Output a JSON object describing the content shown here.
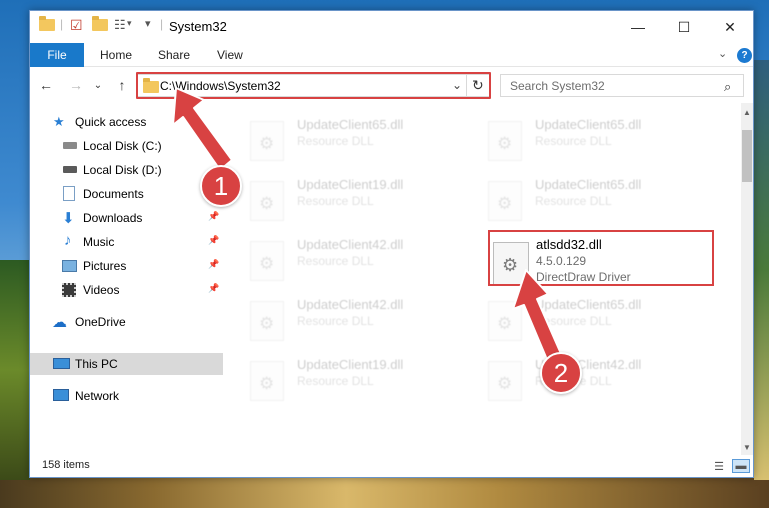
{
  "window": {
    "title": "System32"
  },
  "window_controls": {
    "minimize": "—",
    "maximize": "☐",
    "close": "✕"
  },
  "ribbon": {
    "file": "File",
    "tabs": [
      "Home",
      "Share",
      "View"
    ],
    "expand": "⌄",
    "help": "?"
  },
  "address": {
    "path": "C:\\Windows\\System32",
    "dropdown": "⌄",
    "refresh": "↻"
  },
  "search": {
    "placeholder": "Search System32",
    "icon": "search-icon"
  },
  "nav": {
    "back": "←",
    "forward": "→",
    "recent": "⌄",
    "up": "↑"
  },
  "sidebar": {
    "items": [
      {
        "label": "Quick access",
        "icon": "star-icon",
        "pinned": false
      },
      {
        "label": "Local Disk (C:)",
        "icon": "drive-icon",
        "pinned": true
      },
      {
        "label": "Local Disk (D:)",
        "icon": "drive-icon",
        "pinned": false
      },
      {
        "label": "Documents",
        "icon": "documents-icon",
        "pinned": true
      },
      {
        "label": "Downloads",
        "icon": "download-icon",
        "pinned": true
      },
      {
        "label": "Music",
        "icon": "music-icon",
        "pinned": true
      },
      {
        "label": "Pictures",
        "icon": "pictures-icon",
        "pinned": true
      },
      {
        "label": "Videos",
        "icon": "videos-icon",
        "pinned": true
      },
      {
        "label": "OneDrive",
        "icon": "cloud-icon",
        "pinned": false
      },
      {
        "label": "This PC",
        "icon": "computer-icon",
        "pinned": false,
        "selected": true
      },
      {
        "label": "Network",
        "icon": "network-icon",
        "pinned": false
      }
    ]
  },
  "files": {
    "left": [
      {
        "name": "UpdateClient65.dll",
        "type": "Resource DLL"
      },
      {
        "name": "UpdateClient19.dll",
        "type": "Resource DLL"
      },
      {
        "name": "UpdateClient42.dll",
        "type": "Resource DLL"
      },
      {
        "name": "UpdateClient42.dll",
        "type": "Resource DLL"
      },
      {
        "name": "UpdateClient19.dll",
        "type": "Resource DLL"
      }
    ],
    "right": [
      {
        "name": "UpdateClient65.dll",
        "type": "Resource DLL"
      },
      {
        "name": "UpdateClient65.dll",
        "type": "Resource DLL"
      },
      {
        "name": "UpdateClient65.dll",
        "type": "Resource DLL"
      },
      {
        "name": "UpdateClient42.dll",
        "type": "Resource DLL"
      }
    ],
    "highlighted": {
      "name": "atlsdd32.dll",
      "version": "4.5.0.129",
      "description": "DirectDraw Driver"
    }
  },
  "status": {
    "item_count": "158 items"
  },
  "annotations": {
    "step1": "1",
    "step2": "2",
    "color": "#d84242"
  }
}
